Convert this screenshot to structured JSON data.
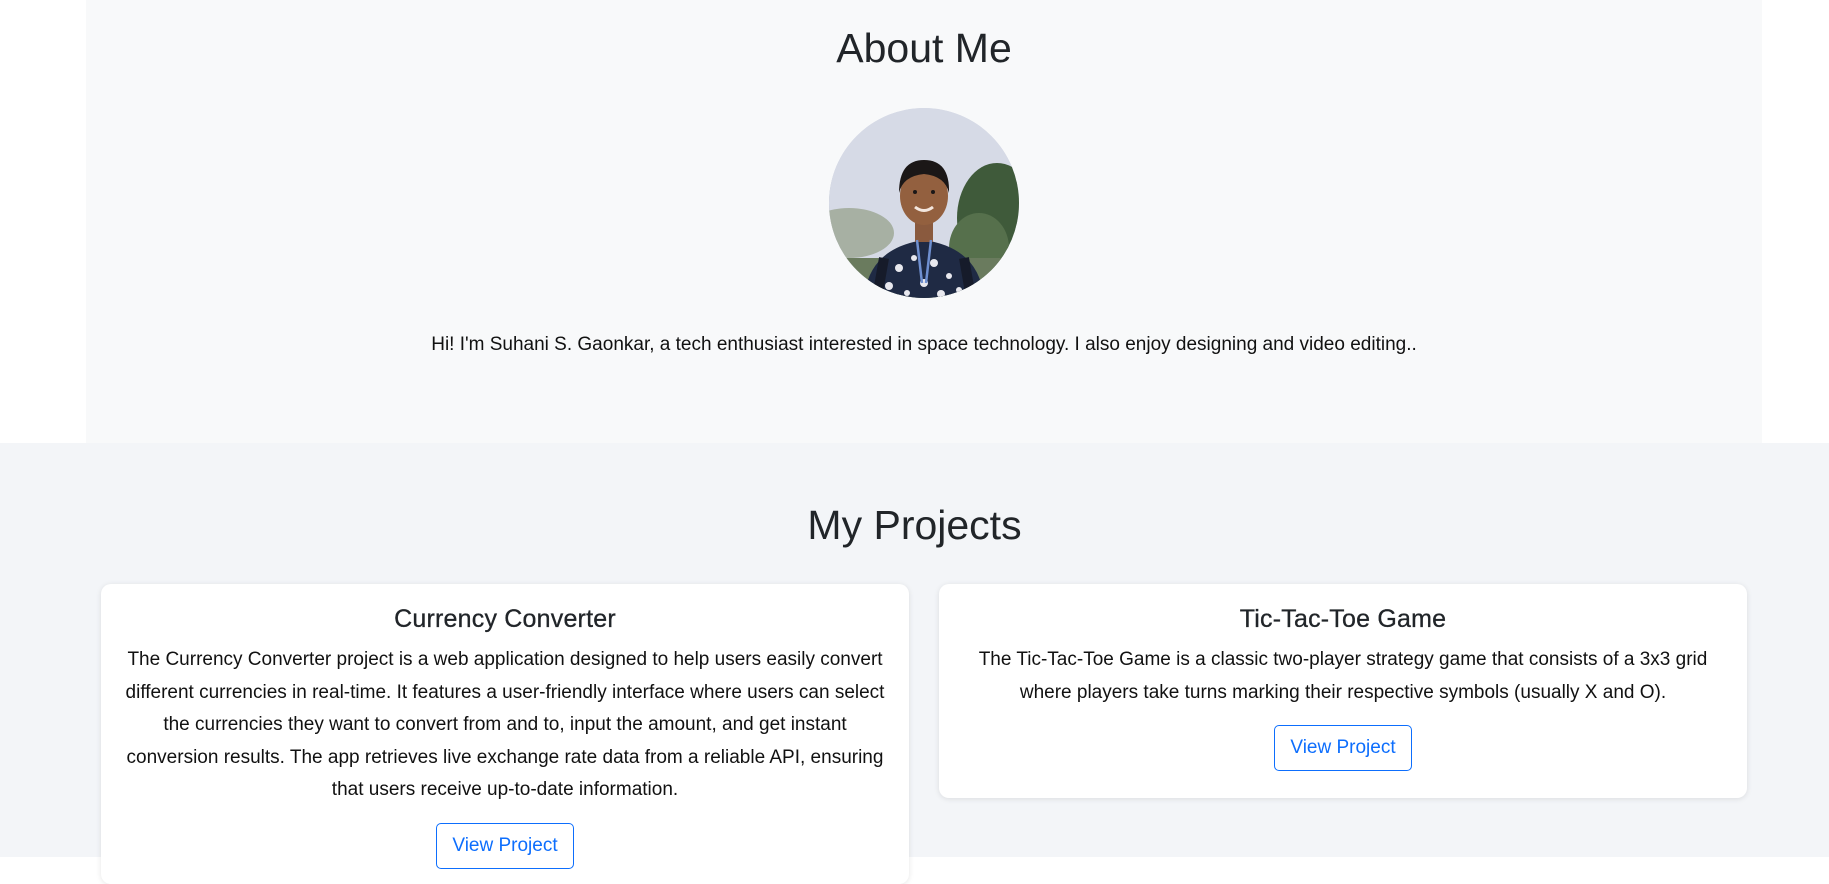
{
  "about": {
    "title": "About Me",
    "intro": "Hi! I'm Suhani S. Gaonkar, a tech enthusiast interested in space technology. I also enjoy designing and video editing..",
    "avatar_icon": "profile-photo"
  },
  "projects": {
    "title": "My Projects",
    "items": [
      {
        "title": "Currency Converter",
        "description": "The Currency Converter project is a web application designed to help users easily convert different currencies in real-time. It features a user-friendly interface where users can select the currencies they want to convert from and to, input the amount, and get instant conversion results. The app retrieves live exchange rate data from a reliable API, ensuring that users receive up-to-date information.",
        "button_label": "View Project"
      },
      {
        "title": "Tic-Tac-Toe Game",
        "description": "The Tic-Tac-Toe Game is a classic two-player strategy game that consists of a 3x3 grid where players take turns marking their respective symbols (usually X and O).",
        "button_label": "View Project"
      }
    ]
  },
  "colors": {
    "primary": "#0d6efd",
    "about_bg": "#f8f9fa",
    "projects_bg": "#f3f5f8",
    "text": "#212529"
  }
}
